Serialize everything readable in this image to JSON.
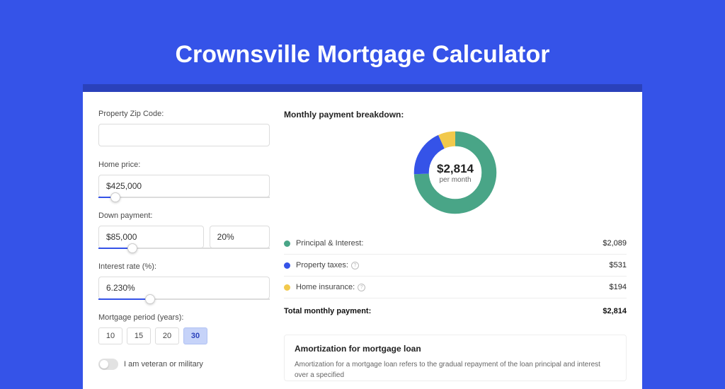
{
  "page_title": "Crownsville Mortgage Calculator",
  "form": {
    "zip_label": "Property Zip Code:",
    "zip_value": "",
    "home_price_label": "Home price:",
    "home_price_value": "$425,000",
    "home_price_slider_pct": 10,
    "down_payment_label": "Down payment:",
    "down_payment_value": "$85,000",
    "down_payment_pct": "20%",
    "down_payment_slider_pct": 20,
    "interest_label": "Interest rate (%):",
    "interest_value": "6.230%",
    "interest_slider_pct": 30,
    "period_label": "Mortgage period (years):",
    "period_options": [
      "10",
      "15",
      "20",
      "30"
    ],
    "period_selected": "30",
    "veteran_label": "I am veteran or military"
  },
  "breakdown": {
    "title": "Monthly payment breakdown:",
    "total_value": "$2,814",
    "total_sub": "per month",
    "items": [
      {
        "label": "Principal & Interest:",
        "value": "$2,089",
        "color": "#49a587",
        "has_info": false
      },
      {
        "label": "Property taxes:",
        "value": "$531",
        "color": "#3553e8",
        "has_info": true
      },
      {
        "label": "Home insurance:",
        "value": "$194",
        "color": "#f2c94c",
        "has_info": true
      }
    ],
    "total_row": {
      "label": "Total monthly payment:",
      "value": "$2,814"
    }
  },
  "amortization": {
    "title": "Amortization for mortgage loan",
    "text": "Amortization for a mortgage loan refers to the gradual repayment of the loan principal and interest over a specified"
  },
  "chart_data": {
    "type": "pie",
    "title": "Monthly payment breakdown",
    "series": [
      {
        "name": "Principal & Interest",
        "value": 2089,
        "color": "#49a587"
      },
      {
        "name": "Property taxes",
        "value": 531,
        "color": "#3553e8"
      },
      {
        "name": "Home insurance",
        "value": 194,
        "color": "#f2c94c"
      }
    ],
    "total": 2814,
    "unit": "USD per month"
  }
}
